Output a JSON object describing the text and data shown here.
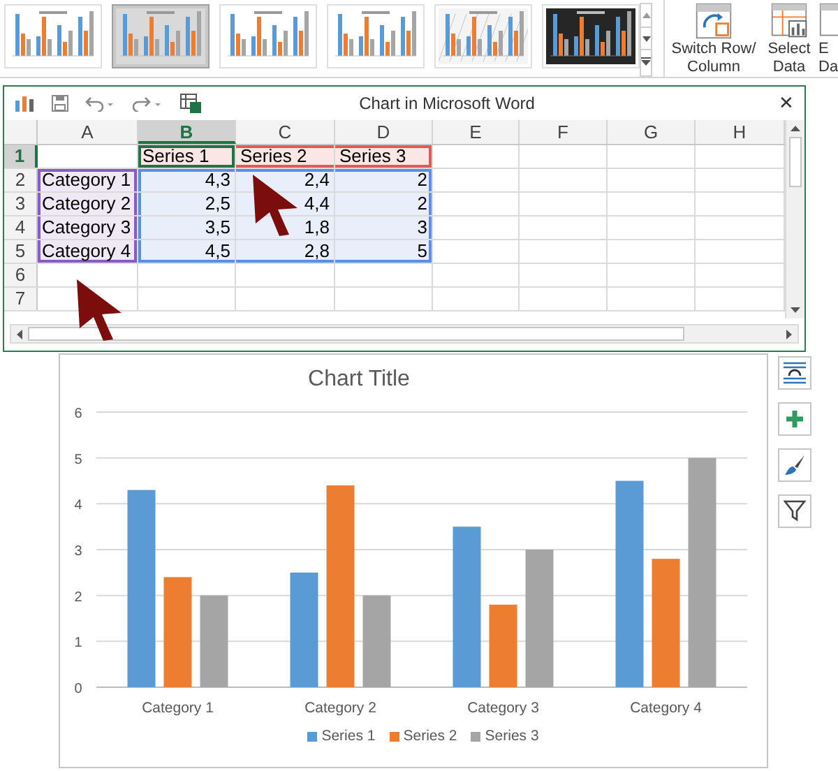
{
  "ribbon": {
    "chart_styles": [
      {
        "kind": "plain",
        "selected": false
      },
      {
        "kind": "shaded",
        "selected": true
      },
      {
        "kind": "plain",
        "selected": false
      },
      {
        "kind": "plain",
        "selected": false
      },
      {
        "kind": "hatched",
        "selected": false
      },
      {
        "kind": "dark",
        "selected": false
      }
    ],
    "buttons": [
      {
        "kind": "switch",
        "label": "Switch Row/ Column"
      },
      {
        "kind": "select",
        "label": "Select Data"
      },
      {
        "kind": "edit",
        "label": "E Da"
      }
    ]
  },
  "sheet_window": {
    "title": "Chart in Microsoft Word",
    "close": "✕",
    "columns": [
      {
        "label": "A",
        "selected": false
      },
      {
        "label": "B",
        "selected": true
      },
      {
        "label": "C",
        "selected": false
      },
      {
        "label": "D",
        "selected": false
      },
      {
        "label": "E",
        "selected": false
      },
      {
        "label": "F",
        "selected": false
      },
      {
        "label": "G",
        "selected": false
      },
      {
        "label": "H",
        "selected": false
      }
    ],
    "rows": [
      {
        "label": "1",
        "selected": true,
        "cells": [
          {
            "kind": "blank",
            "selected": false
          },
          {
            "kind": "series",
            "text": "Series 1",
            "selected": true
          },
          {
            "kind": "series",
            "text": "Series 2",
            "selected": false
          },
          {
            "kind": "series",
            "text": "Series 3",
            "selected": false
          }
        ]
      },
      {
        "label": "2",
        "selected": false,
        "cells": [
          {
            "kind": "category",
            "text": "Category 1",
            "selected": false
          },
          {
            "kind": "value",
            "text": "4,3",
            "selected": false
          },
          {
            "kind": "value",
            "text": "2,4",
            "selected": false
          },
          {
            "kind": "value",
            "text": "2",
            "selected": false
          }
        ]
      },
      {
        "label": "3",
        "selected": false,
        "cells": [
          {
            "kind": "category",
            "text": "Category 2",
            "selected": false
          },
          {
            "kind": "value",
            "text": "2,5",
            "selected": false
          },
          {
            "kind": "value",
            "text": "4,4",
            "selected": false
          },
          {
            "kind": "value",
            "text": "2",
            "selected": false
          }
        ]
      },
      {
        "label": "4",
        "selected": false,
        "cells": [
          {
            "kind": "category",
            "text": "Category 3",
            "selected": false
          },
          {
            "kind": "value",
            "text": "3,5",
            "selected": false
          },
          {
            "kind": "value",
            "text": "1,8",
            "selected": false
          },
          {
            "kind": "value",
            "text": "3",
            "selected": false
          }
        ]
      },
      {
        "label": "5",
        "selected": false,
        "cells": [
          {
            "kind": "category",
            "text": "Category 4",
            "selected": false
          },
          {
            "kind": "value",
            "text": "4,5",
            "selected": false
          },
          {
            "kind": "value",
            "text": "2,8",
            "selected": false
          },
          {
            "kind": "value",
            "text": "5",
            "selected": false
          }
        ]
      },
      {
        "label": "6",
        "selected": false,
        "cells": []
      },
      {
        "label": "7",
        "selected": false,
        "cells": []
      }
    ]
  },
  "chart": {
    "chart_data": {
      "type": "bar",
      "title": "Chart Title",
      "categories": [
        "Category 1",
        "Category 2",
        "Category 3",
        "Category 4"
      ],
      "series": [
        {
          "name": "Series 1",
          "color": "#5b9bd5",
          "values": [
            4.3,
            2.5,
            3.5,
            4.5
          ]
        },
        {
          "name": "Series 2",
          "color": "#ed7d31",
          "values": [
            2.4,
            4.4,
            1.8,
            2.8
          ]
        },
        {
          "name": "Series 3",
          "color": "#a5a5a5",
          "values": [
            2,
            2,
            3,
            5
          ]
        }
      ],
      "ylim": [
        0,
        6
      ],
      "yticks": [
        0,
        1,
        2,
        3,
        4,
        5,
        6
      ],
      "grid": true,
      "legend": true
    },
    "side_buttons": [
      {
        "kind": "layout"
      },
      {
        "kind": "elements"
      },
      {
        "kind": "styles"
      },
      {
        "kind": "filter"
      }
    ]
  }
}
